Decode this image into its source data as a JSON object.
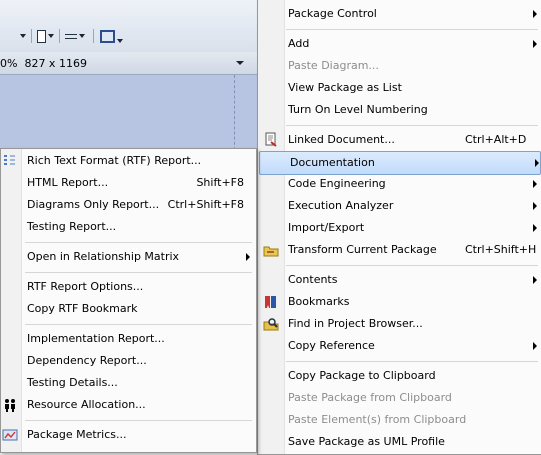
{
  "background": {
    "zoom_text": "0%  827 x 1169"
  },
  "right_menu": [
    {
      "label": "Package Control",
      "submenu": true
    },
    {
      "sep": true
    },
    {
      "label": "Add",
      "submenu": true
    },
    {
      "label": "Paste Diagram...",
      "disabled": true
    },
    {
      "label": "View Package as List"
    },
    {
      "label": "Turn On Level Numbering"
    },
    {
      "sep": true
    },
    {
      "label": "Linked Document...",
      "shortcut": "Ctrl+Alt+D",
      "icon": "linked-document-icon"
    },
    {
      "label": "Documentation",
      "submenu": true,
      "highlighted": true
    },
    {
      "label": "Code Engineering",
      "submenu": true
    },
    {
      "label": "Execution Analyzer",
      "submenu": true
    },
    {
      "label": "Import/Export",
      "submenu": true
    },
    {
      "label": "Transform Current Package",
      "shortcut": "Ctrl+Shift+H",
      "icon": "transform-icon"
    },
    {
      "sep": true
    },
    {
      "label": "Contents",
      "submenu": true
    },
    {
      "label": "Bookmarks",
      "icon": "bookmarks-icon"
    },
    {
      "label": "Find in Project Browser...",
      "icon": "find-icon"
    },
    {
      "label": "Copy Reference",
      "submenu": true
    },
    {
      "sep": true
    },
    {
      "label": "Copy Package to Clipboard"
    },
    {
      "label": "Paste Package from Clipboard",
      "disabled": true
    },
    {
      "label": "Paste Element(s) from Clipboard",
      "disabled": true
    },
    {
      "label": "Save Package as UML Profile"
    }
  ],
  "left_menu": [
    {
      "label": "Rich Text Format (RTF) Report...",
      "icon": "rtf-report-icon"
    },
    {
      "label": "HTML Report...",
      "shortcut": "Shift+F8"
    },
    {
      "label": "Diagrams Only Report...",
      "shortcut": "Ctrl+Shift+F8"
    },
    {
      "label": "Testing Report..."
    },
    {
      "sep": true
    },
    {
      "label": "Open in Relationship Matrix",
      "submenu": true
    },
    {
      "sep": true
    },
    {
      "label": "RTF Report Options..."
    },
    {
      "label": "Copy RTF Bookmark"
    },
    {
      "sep": true
    },
    {
      "label": "Implementation Report..."
    },
    {
      "label": "Dependency Report..."
    },
    {
      "label": "Testing Details..."
    },
    {
      "label": "Resource Allocation...",
      "icon": "resource-allocation-icon"
    },
    {
      "sep": true
    },
    {
      "label": "Package Metrics...",
      "icon": "package-metrics-icon"
    }
  ]
}
